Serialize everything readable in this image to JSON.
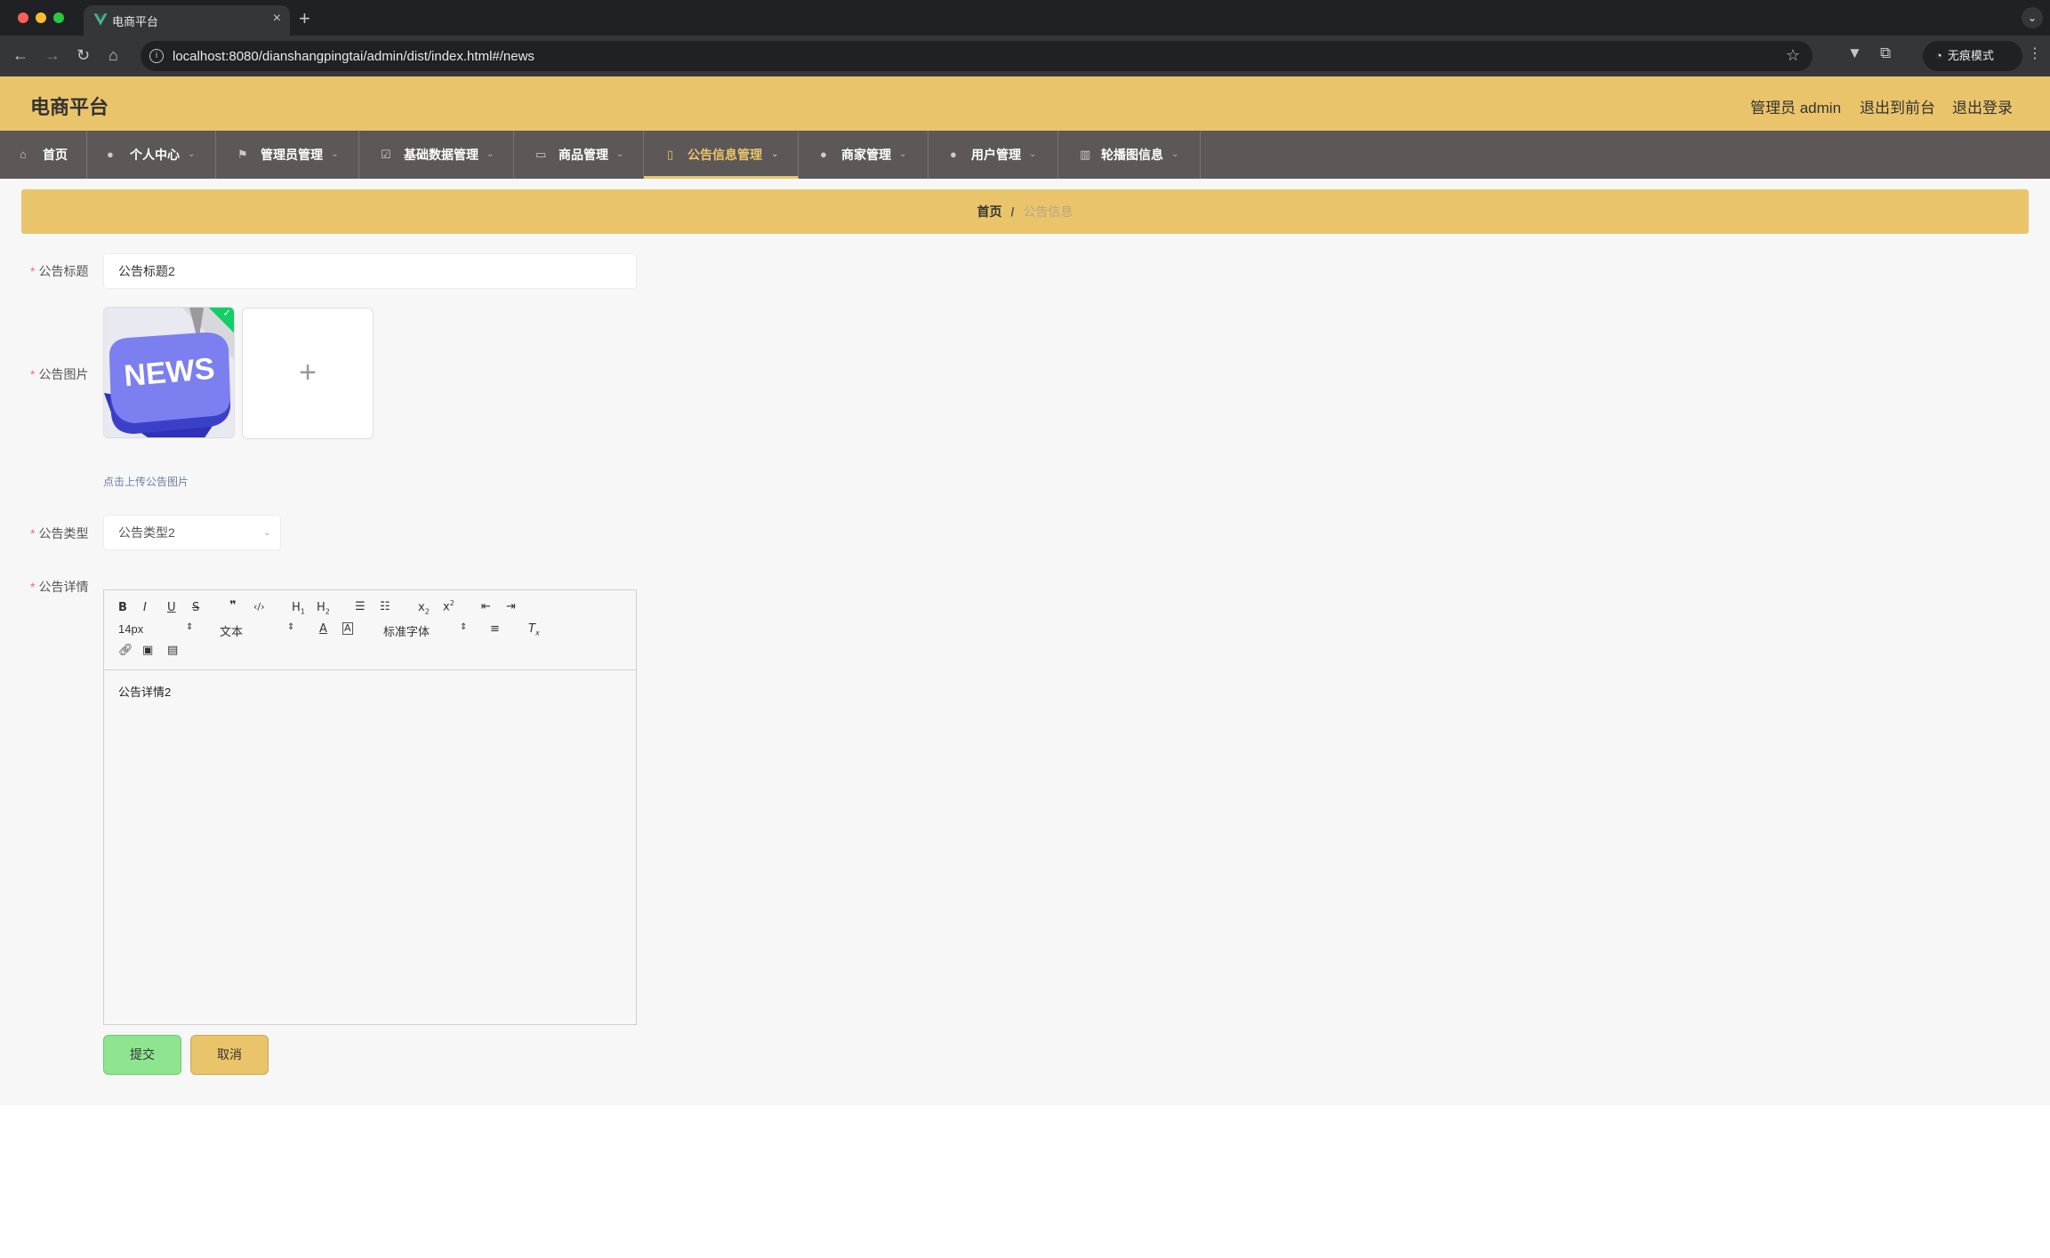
{
  "browser": {
    "tab_title": "电商平台",
    "url": "localhost:8080/dianshangpingtai/admin/dist/index.html#/news",
    "incognito_label": "无痕模式"
  },
  "header": {
    "brand": "电商平台",
    "user_label": "管理员 admin",
    "to_front": "退出到前台",
    "logout": "退出登录"
  },
  "nav": {
    "items": [
      {
        "label": "首页",
        "icon": "home-icon"
      },
      {
        "label": "个人中心",
        "icon": "user-icon"
      },
      {
        "label": "管理员管理",
        "icon": "flag-icon"
      },
      {
        "label": "基础数据管理",
        "icon": "checkbox-icon"
      },
      {
        "label": "商品管理",
        "icon": "card-icon"
      },
      {
        "label": "公告信息管理",
        "icon": "mic-icon"
      },
      {
        "label": "商家管理",
        "icon": "location-icon"
      },
      {
        "label": "用户管理",
        "icon": "user-icon"
      },
      {
        "label": "轮播图信息",
        "icon": "bar-chart-icon"
      }
    ],
    "active": "公告信息管理"
  },
  "breadcrumb": {
    "home": "首页",
    "separator": "/",
    "current": "公告信息"
  },
  "form": {
    "title_label": "公告标题",
    "title_value": "公告标题2",
    "image_label": "公告图片",
    "image_text": "NEWS",
    "upload_plus": "+",
    "upload_hint": "点击上传公告图片",
    "type_label": "公告类型",
    "type_value": "公告类型2",
    "detail_label": "公告详情",
    "detail_value": "公告详情2",
    "submit": "提交",
    "cancel": "取消"
  },
  "editor": {
    "font_size": "14px",
    "header_select": "文本",
    "font_family": "标准字体"
  },
  "colors": {
    "accent": "#e9c46a",
    "nav_bg": "#5d5757",
    "submit_bg": "#8fe58f",
    "required": "#f56c6c"
  }
}
